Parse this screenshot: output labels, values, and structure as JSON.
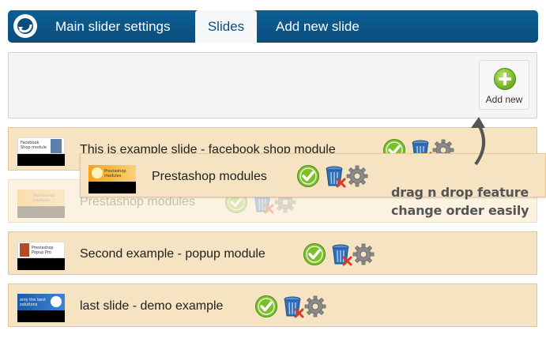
{
  "nav": {
    "tabs": [
      {
        "label": "Main slider settings",
        "active": false
      },
      {
        "label": "Slides",
        "active": true
      },
      {
        "label": "Add new slide",
        "active": false
      }
    ],
    "logo_icon": "refresh-logo-icon"
  },
  "add_button": {
    "label": "Add new",
    "icon": "plus-circle-icon"
  },
  "slides": [
    {
      "title": "This is example slide - facebook shop module",
      "thumb_text": "Facebook Shop module"
    },
    {
      "title": "Prestashop modules",
      "thumb_text": "Prestashop modules",
      "state": "placeholder"
    },
    {
      "title": "Second example - popup module",
      "thumb_text": "Prestashop Popup Pro"
    },
    {
      "title": "last slide - demo example",
      "thumb_text": "only the best solutions"
    }
  ],
  "dragged_slide": {
    "title": "Prestashop modules",
    "thumb_text": "Prestashop modules"
  },
  "annotation": {
    "line1": "drag n drop feature",
    "line2": "change order easily"
  },
  "colors": {
    "nav_bg": "#0a4d7c",
    "row_bg": "#f5e3c2",
    "enabled_green": "#7cc02a",
    "trash_blue": "#2e6fb7",
    "delete_red": "#d93a2a",
    "gear_gray": "#8a8a8a"
  }
}
